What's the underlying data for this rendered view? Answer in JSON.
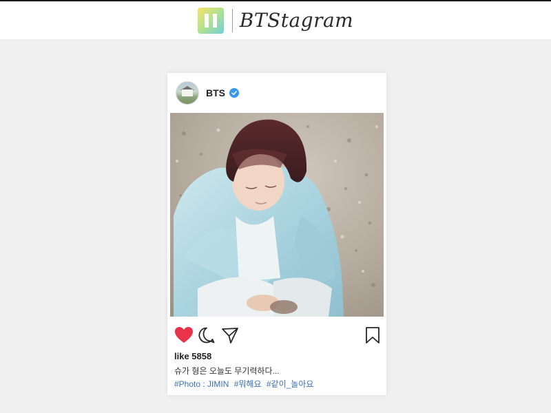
{
  "app": {
    "brand_name": "BTStagram"
  },
  "post": {
    "account_name": "BTS",
    "verified": true,
    "likes_text": "like 5858",
    "caption": "슈가 형은 오늘도 무기력하다...",
    "tags": [
      "#Photo : JIMIN",
      "#뭐해요",
      "#같이_놀아요"
    ]
  },
  "icons": {
    "like": "heart-icon",
    "comment": "comment-bubble-icon",
    "share": "paper-plane-icon",
    "save": "bookmark-icon",
    "verified": "verified-check-icon"
  },
  "colors": {
    "page_background": "#f0f0f0",
    "like_filled": "#e8334a",
    "verified_badge": "#3897f0",
    "hashtag": "#3b6fb8"
  }
}
